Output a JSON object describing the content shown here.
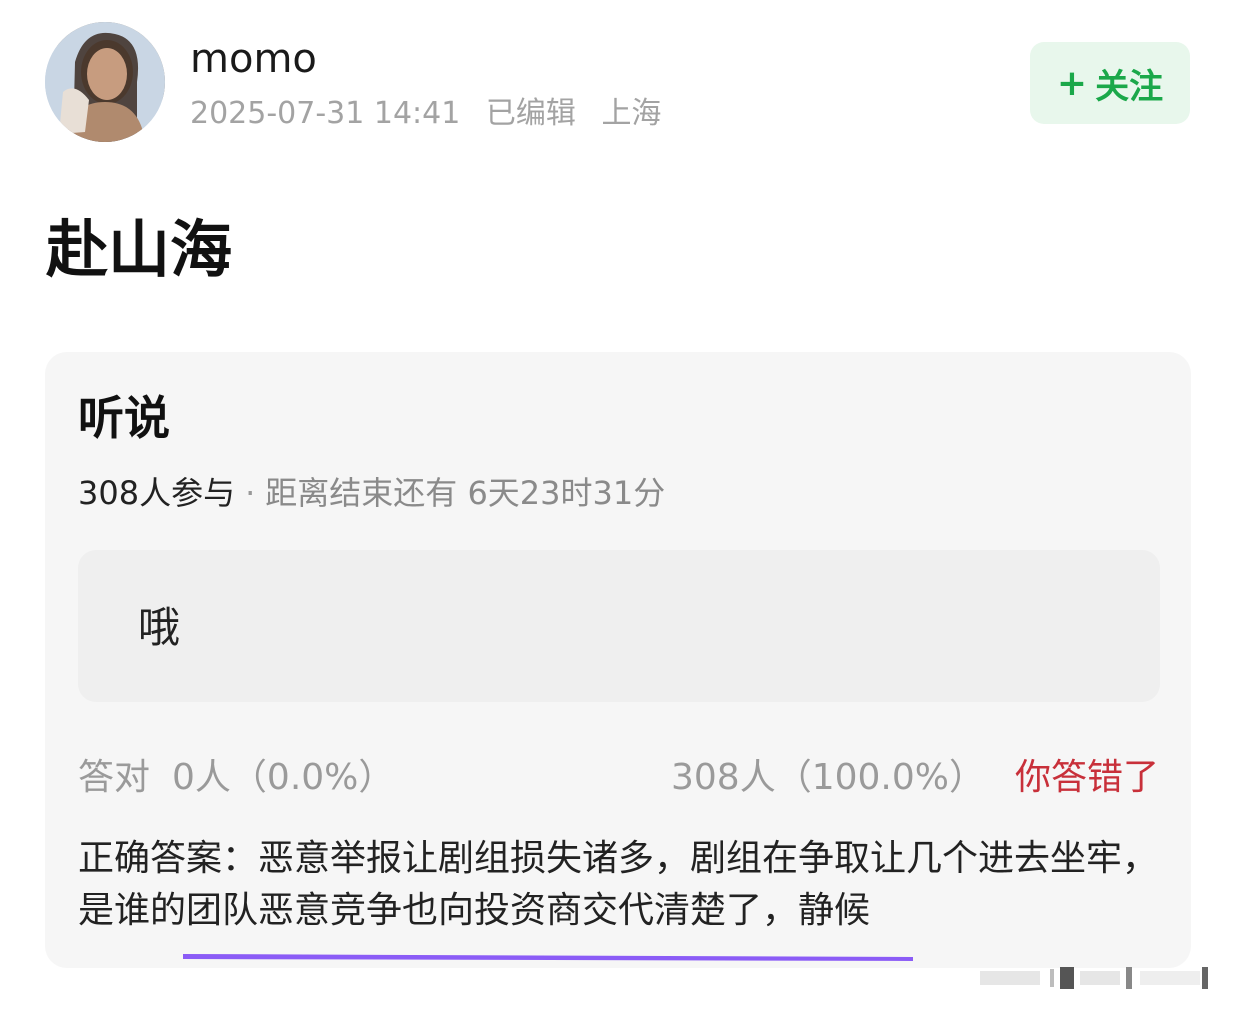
{
  "post": {
    "username": "momo",
    "datetime": "2025-07-31 14:41",
    "edited": "已编辑",
    "location": "上海",
    "follow_label": "关注",
    "title": "赴山海"
  },
  "quiz": {
    "title": "听说",
    "participants": "308人参与",
    "separator": "·",
    "remaining": "距离结束还有 6天23时31分",
    "option": "哦",
    "correct_label": "答对",
    "correct_count": "0人（0.0%）",
    "wrong_count": "308人（100.0%）",
    "wrong_label": "你答错了",
    "answer": "正确答案：恶意举报让剧组损失诸多，剧组在争取让几个进去坐牢，是谁的团队恶意竞争也向投资商交代清楚了，静候"
  },
  "icons": {
    "avatar": "avatar-photo",
    "follow": "plus-icon"
  },
  "colors": {
    "follow_text": "#1ba84a",
    "follow_bg": "#e8f7ec",
    "wrong": "#c8303a",
    "underline": "#8b5cf6"
  }
}
